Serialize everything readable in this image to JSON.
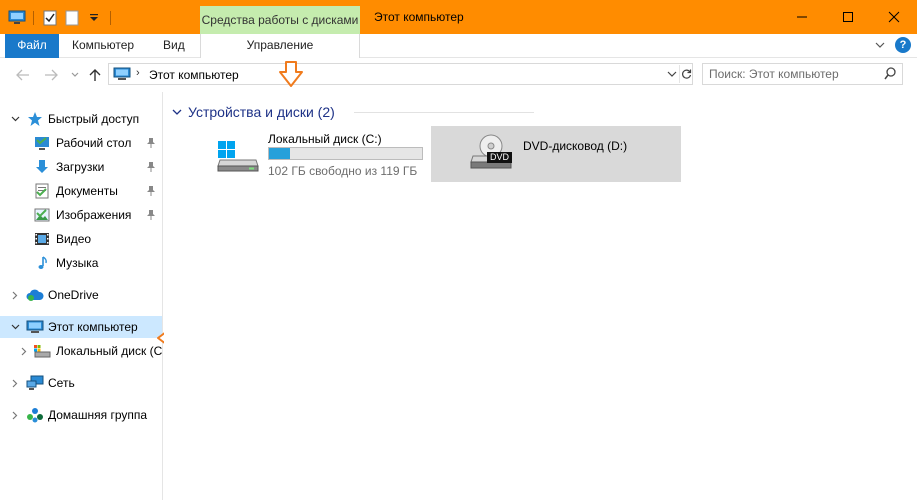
{
  "window": {
    "title": "Этот компьютер",
    "context_tab": "Средства работы с дисками"
  },
  "ribbon": {
    "tabs": [
      {
        "label": "Файл"
      },
      {
        "label": "Компьютер"
      },
      {
        "label": "Вид"
      },
      {
        "label": "Управление"
      }
    ]
  },
  "address": {
    "crumb": "Этот компьютер"
  },
  "search": {
    "placeholder": "Поиск: Этот компьютер"
  },
  "nav": {
    "quick_access": "Быстрый доступ",
    "quick_items": [
      {
        "label": "Рабочий стол"
      },
      {
        "label": "Загрузки"
      },
      {
        "label": "Документы"
      },
      {
        "label": "Изображения"
      },
      {
        "label": "Видео"
      },
      {
        "label": "Музыка"
      }
    ],
    "onedrive": "OneDrive",
    "this_pc": "Этот компьютер",
    "local_disk": "Локальный диск (C",
    "network": "Сеть",
    "homegroup": "Домашняя группа"
  },
  "content": {
    "group_title": "Устройства и диски (2)",
    "drives": [
      {
        "name": "Локальный диск (C:)",
        "subtitle": "102 ГБ свободно из 119 ГБ",
        "used_fraction": 0.14
      },
      {
        "name": "DVD-дисковод (D:)",
        "badge": "DVD"
      }
    ]
  },
  "colors": {
    "titlebar": "#ff8c00",
    "context_tab": "#c5ecae",
    "file_tab": "#1979ca",
    "selection": "#cce8ff",
    "progress": "#26a0da",
    "group_title": "#1e3287"
  }
}
